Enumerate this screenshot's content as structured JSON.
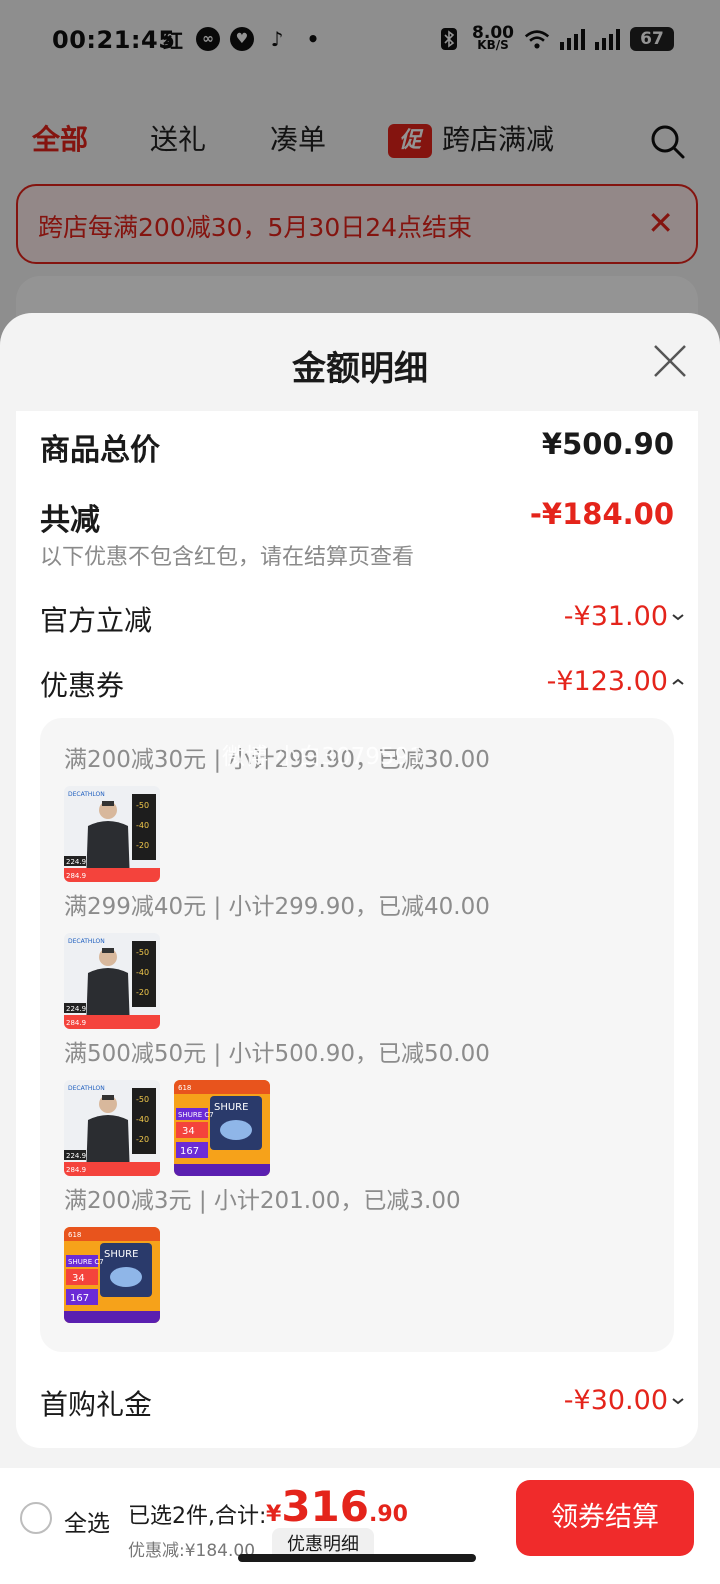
{
  "status_bar": {
    "time": "00:21:45",
    "left_icons": [
      "红",
      "cloud-icon",
      "heart-pulse-icon",
      "tiktok-icon",
      "•"
    ],
    "net_speed_value": "8.00",
    "net_speed_unit": "KB/S",
    "battery": "67"
  },
  "tabs": [
    {
      "label": "全部",
      "active": true
    },
    {
      "label": "送礼",
      "active": false
    },
    {
      "label": "凑单",
      "active": false
    },
    {
      "label": "跨店满减",
      "active": false,
      "badge": "促"
    }
  ],
  "notice": {
    "text": "跨店每满200减30，5月30日24点结束",
    "close": "✕"
  },
  "sheet": {
    "title": "金额明细",
    "rows": {
      "total_price": {
        "label": "商品总价",
        "value": "¥500.90"
      },
      "total_discount": {
        "label": "共减",
        "value": "-¥184.00",
        "note": "以下优惠不包含红包，请在结算页查看"
      },
      "official": {
        "label": "官方立减",
        "value": "-¥31.00"
      },
      "coupon": {
        "label": "优惠券",
        "value": "-¥123.00"
      },
      "first_purchase": {
        "label": "首购礼金",
        "value": "-¥30.00"
      }
    },
    "coupon_groups": [
      {
        "text": "满200减30元 | 小计299.90，已减30.00",
        "items": [
          "decathlon-jacket"
        ]
      },
      {
        "text": "满299减40元 | 小计299.90，已减40.00",
        "items": [
          "decathlon-jacket"
        ]
      },
      {
        "text": "满500减50元 | 小计500.90，已减50.00",
        "items": [
          "decathlon-jacket",
          "shure-product"
        ]
      },
      {
        "text": "满200减3元 | 小计201.00，已减3.00",
        "items": [
          "shure-product"
        ]
      }
    ],
    "watermark": "微博 小白3079591"
  },
  "bottom_bar": {
    "select_all": "全选",
    "selected": "已选2件,合计:",
    "currency": "¥",
    "total_int": "316",
    "total_dec": ".90",
    "discount": "优惠减:¥184.00",
    "detail_button": "优惠明细",
    "checkout_button": "领券结算"
  },
  "colors": {
    "accent": "#e4241b",
    "checkout": "#f02b2b"
  }
}
